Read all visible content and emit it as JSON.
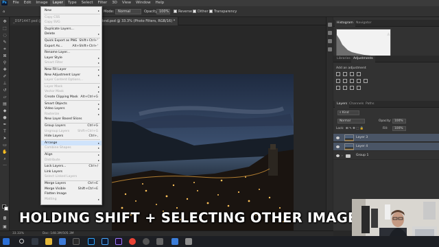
{
  "menubar": {
    "items": [
      "File",
      "Edit",
      "Image",
      "Layer",
      "Type",
      "Select",
      "Filter",
      "3D",
      "View",
      "Window",
      "Help"
    ]
  },
  "options": {
    "mode_label": "Mode:",
    "mode_value": "Normal",
    "opacity_label": "Opacity:",
    "opacity_value": "100%",
    "reverse_label": "Reverse",
    "dither_label": "Dither",
    "transparency_label": "Transparency"
  },
  "tabs": {
    "first": "_DSF1447.psd @",
    "second": "knd.psd @ 33.3% (Photo Filters, RGB/16) *"
  },
  "layer_menu": {
    "items": [
      {
        "label": "New",
        "shortcut": "",
        "arrow": true,
        "disabled": false
      },
      {
        "label": "Copy CSS",
        "shortcut": "",
        "arrow": false,
        "disabled": true
      },
      {
        "label": "Copy SVG",
        "shortcut": "",
        "arrow": false,
        "disabled": true
      },
      {
        "label": "Duplicate Layers...",
        "shortcut": "",
        "arrow": false,
        "disabled": false
      },
      {
        "label": "Delete",
        "shortcut": "",
        "arrow": true,
        "disabled": false
      },
      {
        "label": "Quick Export as PNG",
        "shortcut": "Shift+Ctrl+'",
        "arrow": false,
        "disabled": false
      },
      {
        "label": "Export As...",
        "shortcut": "Alt+Shift+Ctrl+'",
        "arrow": false,
        "disabled": false
      },
      {
        "label": "Rename Layer...",
        "shortcut": "",
        "arrow": false,
        "disabled": false
      },
      {
        "label": "Layer Style",
        "shortcut": "",
        "arrow": true,
        "disabled": false
      },
      {
        "label": "Smart Filter",
        "shortcut": "",
        "arrow": true,
        "disabled": true
      },
      {
        "label": "New Fill Layer",
        "shortcut": "",
        "arrow": true,
        "disabled": false
      },
      {
        "label": "New Adjustment Layer",
        "shortcut": "",
        "arrow": true,
        "disabled": false
      },
      {
        "label": "Layer Content Options...",
        "shortcut": "",
        "arrow": false,
        "disabled": true
      },
      {
        "label": "Layer Mask",
        "shortcut": "",
        "arrow": true,
        "disabled": true
      },
      {
        "label": "Vector Mask",
        "shortcut": "",
        "arrow": true,
        "disabled": true
      },
      {
        "label": "Create Clipping Mask",
        "shortcut": "Alt+Ctrl+G",
        "arrow": false,
        "disabled": false
      },
      {
        "label": "Smart Objects",
        "shortcut": "",
        "arrow": true,
        "disabled": false
      },
      {
        "label": "Video Layers",
        "shortcut": "",
        "arrow": true,
        "disabled": false
      },
      {
        "label": "Rasterize",
        "shortcut": "",
        "arrow": true,
        "disabled": true
      },
      {
        "label": "New Layer Based Slices",
        "shortcut": "",
        "arrow": false,
        "disabled": false
      },
      {
        "label": "Group Layers",
        "shortcut": "Ctrl+G",
        "arrow": false,
        "disabled": false
      },
      {
        "label": "Ungroup Layers",
        "shortcut": "Shift+Ctrl+G",
        "arrow": false,
        "disabled": true
      },
      {
        "label": "Hide Layers",
        "shortcut": "Ctrl+,",
        "arrow": false,
        "disabled": false
      },
      {
        "label": "Arrange",
        "shortcut": "",
        "arrow": true,
        "disabled": false
      },
      {
        "label": "Combine Shapes",
        "shortcut": "",
        "arrow": true,
        "disabled": true
      },
      {
        "label": "Align",
        "shortcut": "",
        "arrow": true,
        "disabled": false
      },
      {
        "label": "Distribute",
        "shortcut": "",
        "arrow": true,
        "disabled": true
      },
      {
        "label": "Lock Layers...",
        "shortcut": "Ctrl+/",
        "arrow": false,
        "disabled": false
      },
      {
        "label": "Link Layers",
        "shortcut": "",
        "arrow": false,
        "disabled": false
      },
      {
        "label": "Select Linked Layers",
        "shortcut": "",
        "arrow": false,
        "disabled": true
      },
      {
        "label": "Merge Layers",
        "shortcut": "Ctrl+E",
        "arrow": false,
        "disabled": false
      },
      {
        "label": "Merge Visible",
        "shortcut": "Shift+Ctrl+E",
        "arrow": false,
        "disabled": false
      },
      {
        "label": "Flatten Image",
        "shortcut": "",
        "arrow": false,
        "disabled": false
      },
      {
        "label": "Matting",
        "shortcut": "",
        "arrow": true,
        "disabled": true
      }
    ]
  },
  "panels": {
    "histogram_tab": "Histogram",
    "navigator_tab": "Navigator",
    "libraries_tab": "Libraries",
    "adjustments_tab": "Adjustments",
    "add_adjustment": "Add an adjustment",
    "layers_tab": "Layers",
    "channels_tab": "Channels",
    "paths_tab": "Paths",
    "kind_label": "Kind",
    "blend_mode": "Normal",
    "opacity_label": "Opacity:",
    "opacity_value": "100%",
    "lock_label": "Lock:",
    "fill_label": "Fill:",
    "fill_value": "100%",
    "layers": [
      {
        "name": "Layer 3",
        "selected": true,
        "type": "pixel"
      },
      {
        "name": "Layer 4",
        "selected": true,
        "type": "pixel"
      },
      {
        "name": "Group 1",
        "selected": false,
        "type": "group"
      }
    ]
  },
  "status": {
    "zoom": "33.33%",
    "doc": "Doc: 148.3M/505.3M"
  },
  "caption": "HOLDING SHIFT + SELECTING OTHER IMAGE",
  "colors": {
    "menu_bg": "#f0f0f0",
    "selected_layer": "#4a5566",
    "ps_blue": "#31a8ff"
  }
}
